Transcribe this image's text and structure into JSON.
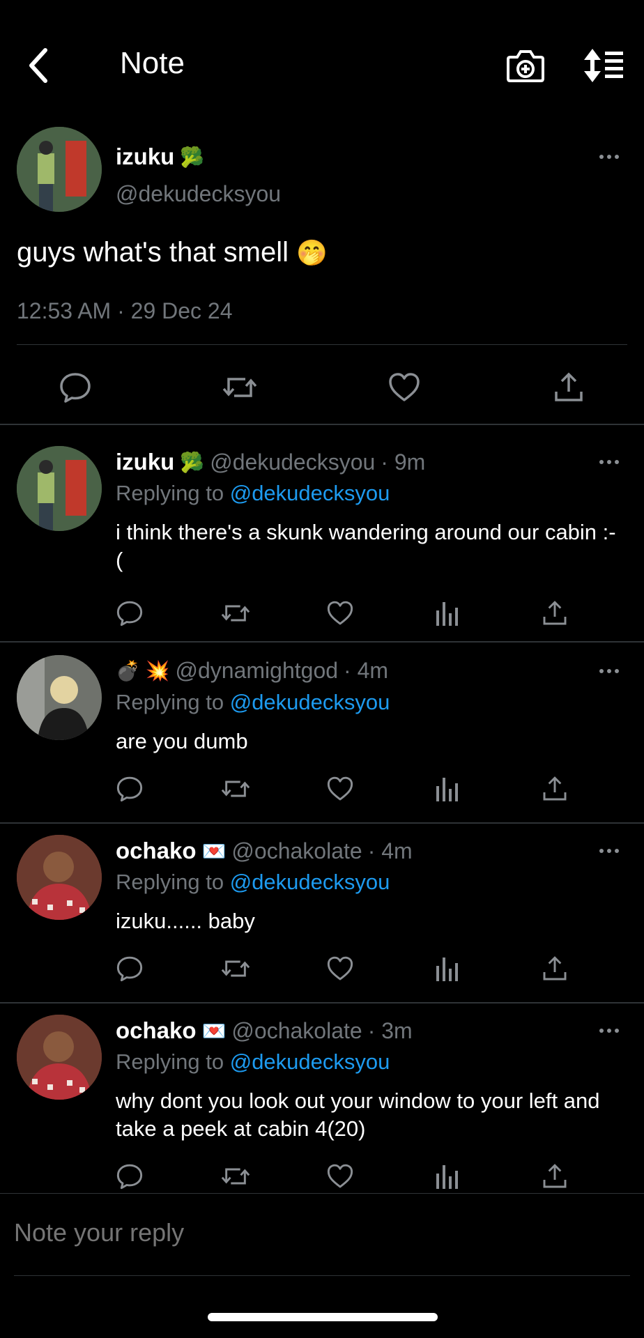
{
  "header": {
    "title": "Note"
  },
  "main_note": {
    "name": "izuku",
    "name_emoji": "🥦",
    "handle": "@dekudecksyou",
    "text": "guys what's that smell",
    "text_emoji": "🤭",
    "timestamp": "12:53 AM · 29 Dec 24"
  },
  "replies": [
    {
      "name": "izuku",
      "name_emoji": "🥦",
      "handle": "@dekudecksyou",
      "time": "· 9m",
      "replying_prefix": "Replying to",
      "replying_to": "@dekudecksyou",
      "text": "i think there's a skunk wandering around our cabin :-("
    },
    {
      "name": "",
      "name_emoji": "💣 💥",
      "handle": "@dynamightgod",
      "time": "· 4m",
      "replying_prefix": "Replying to",
      "replying_to": "@dekudecksyou",
      "text": "are you dumb"
    },
    {
      "name": "ochako",
      "name_emoji": "💌",
      "handle": "@ochakolate",
      "time": "· 4m",
      "replying_prefix": "Replying to",
      "replying_to": "@dekudecksyou",
      "text": "izuku...... baby"
    },
    {
      "name": "ochako",
      "name_emoji": "💌",
      "handle": "@ochakolate",
      "time": "· 3m",
      "replying_prefix": "Replying to",
      "replying_to": "@dekudecksyou",
      "text": "why dont you look out your window to your left and take a peek at cabin 4(20)"
    }
  ],
  "composer": {
    "placeholder": "Note your reply"
  },
  "icons": {
    "back": "chevron-left-icon",
    "camera": "camera-plus-icon",
    "sort": "sort-list-icon",
    "reply": "comment-icon",
    "repost": "repost-icon",
    "like": "heart-icon",
    "views": "bar-chart-icon",
    "share": "share-icon",
    "more": "more-dots-icon"
  },
  "colors": {
    "background": "#000000",
    "text": "#ffffff",
    "muted": "#71767b",
    "accent": "#1d9bf0",
    "divider": "#2f3336"
  }
}
